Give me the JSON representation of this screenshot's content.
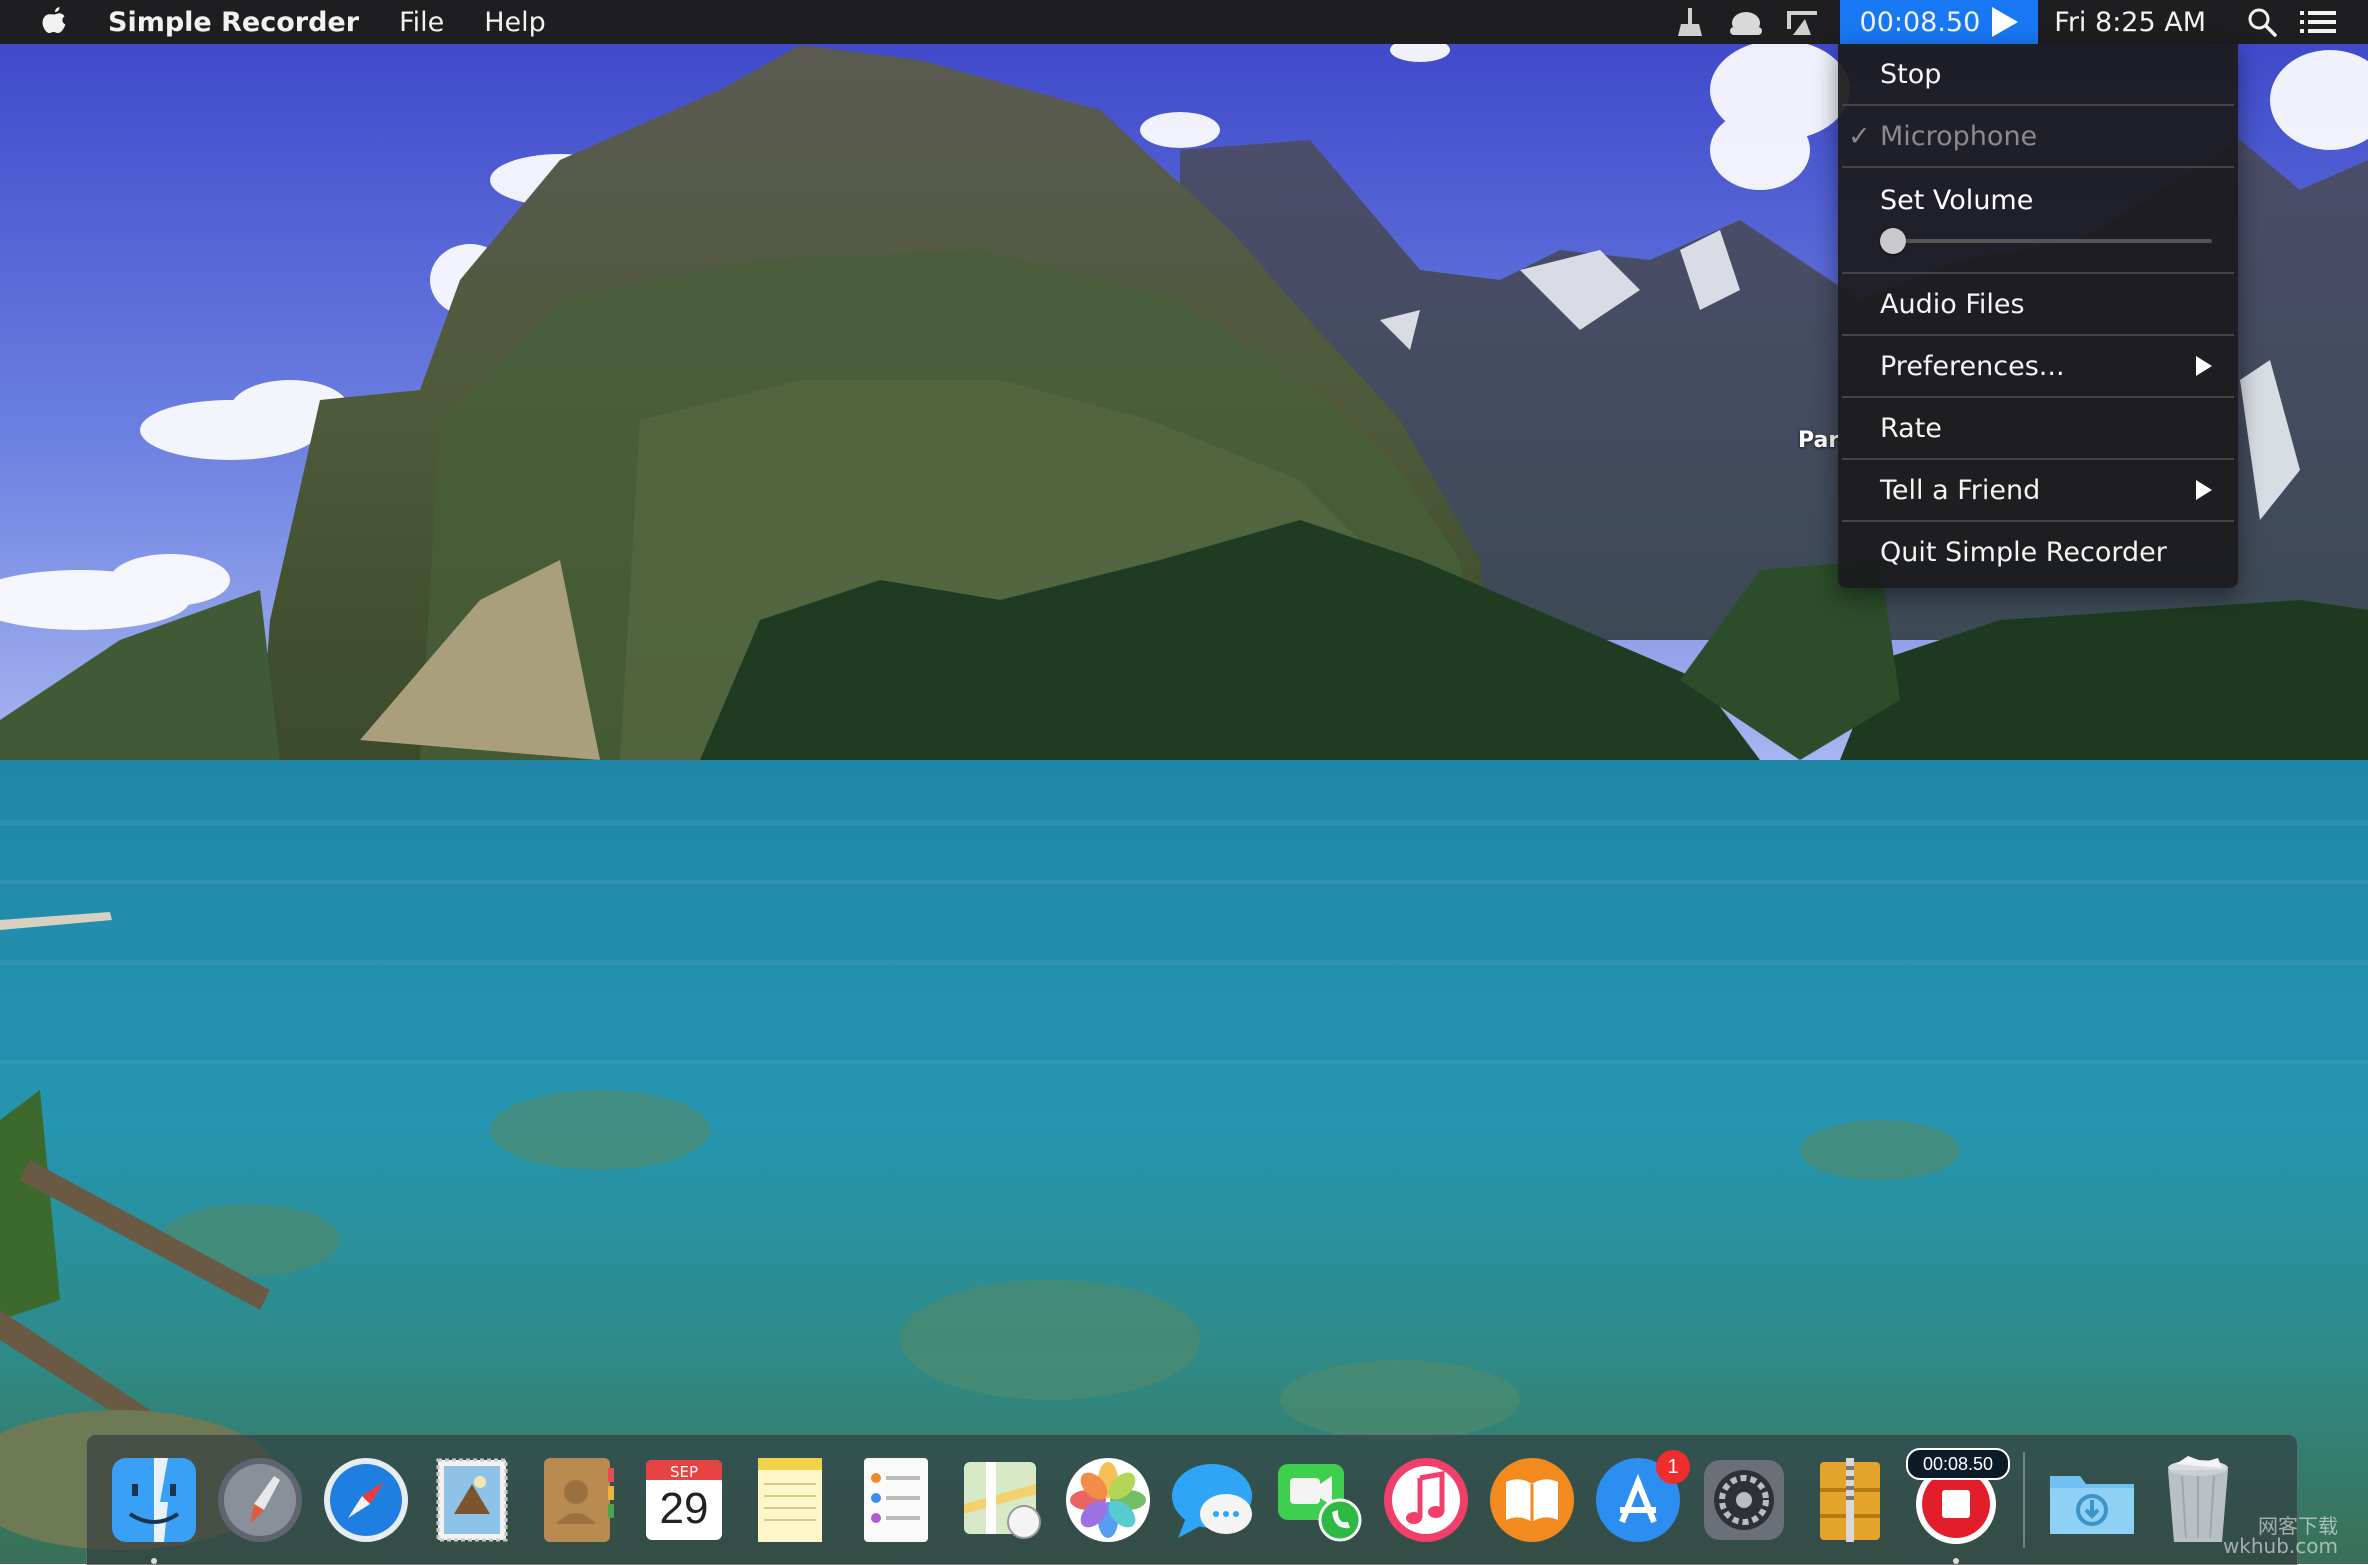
{
  "menubar": {
    "app_name": "Simple Recorder",
    "menus": [
      "File",
      "Help"
    ],
    "recorder_time": "00:08.50",
    "clock": "Fri 8:25 AM"
  },
  "dropdown": {
    "stop": "Stop",
    "microphone": "Microphone",
    "microphone_check": "✓",
    "set_volume": "Set Volume",
    "volume_level": 0.0,
    "audio_files": "Audio Files",
    "preferences": "Preferences...",
    "rate": "Rate",
    "tell_a_friend": "Tell a Friend",
    "quit": "Quit Simple Recorder"
  },
  "background_text": "Par",
  "dock": {
    "calendar_month": "SEP",
    "calendar_day": "29",
    "app_store_badge": "1",
    "recorder_timer": "00:08.50"
  },
  "watermark": {
    "line1": "网客下载",
    "line2": "wkhub.com"
  },
  "colors": {
    "menubar": "#1e1e20",
    "recorder_highlight": "#1877f2",
    "menu_bg": "#1c1c1e"
  }
}
